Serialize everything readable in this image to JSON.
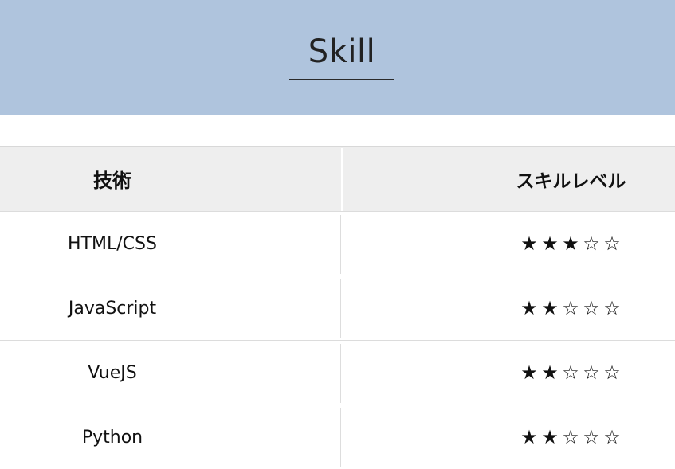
{
  "section": {
    "title": "Skill"
  },
  "table": {
    "headers": {
      "tech": "技術",
      "level": "スキルレベル"
    },
    "rows": [
      {
        "tech": "HTML/CSS",
        "level": 3,
        "max": 5
      },
      {
        "tech": "JavaScript",
        "level": 2,
        "max": 5
      },
      {
        "tech": "VueJS",
        "level": 2,
        "max": 5
      },
      {
        "tech": "Python",
        "level": 2,
        "max": 5
      }
    ]
  },
  "colors": {
    "header_background": "#afc4dd",
    "table_header_background": "#eeeeee"
  },
  "icons": {
    "filled_star": "★",
    "empty_star": "☆"
  }
}
